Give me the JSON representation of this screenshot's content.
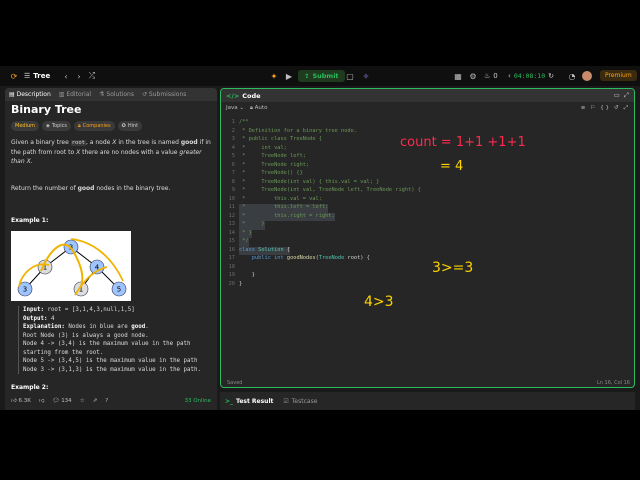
{
  "nav": {
    "problem_list_label": "Tree",
    "submit_label": "Submit",
    "timer": "04:08:10",
    "count": "0",
    "premium_label": "Premium"
  },
  "left": {
    "tabs": [
      {
        "label": "Description",
        "active": true
      },
      {
        "label": "Editorial"
      },
      {
        "label": "Solutions"
      },
      {
        "label": "Submissions"
      }
    ],
    "title": "Binary Tree",
    "chips": {
      "difficulty": "Medium",
      "topics": "Topics",
      "companies": "Companies",
      "hint": "Hint"
    },
    "description": {
      "p1_a": "Given a binary tree",
      "p1_code": "root",
      "p1_b": ", a node",
      "p1_x1": "X",
      "p1_c": "in the tree is named",
      "p1_good": "good",
      "p1_d": "if in the path from root to",
      "p1_x2": "X",
      "p1_e": "there are no nodes with a value",
      "p1_greater": "greater than",
      "p1_x3": "X",
      "p1_f": ".",
      "p2_a": "Return the number of",
      "p2_good": "good",
      "p2_b": "nodes in the binary tree."
    },
    "example1_label": "Example 1:",
    "example1": {
      "input_label": "Input:",
      "input_value": "root = [3,1,4,3,null,1,5]",
      "output_label": "Output:",
      "output_value": "4",
      "expl_label": "Explanation:",
      "expl_text": "Nodes in blue are",
      "expl_good": "good",
      "expl_end": ".",
      "lines": [
        "Root Node (3) is always a good node.",
        "Node 4 -> (3,4) is the maximum value in the path",
        "starting from the root.",
        "Node 5 -> (3,4,5) is the maximum value in the path",
        "Node 3 -> (3,1,3) is the maximum value in the path."
      ]
    },
    "tree_nodes": [
      "3",
      "1",
      "4",
      "3",
      "1",
      "5"
    ],
    "example2_label": "Example 2:",
    "example2_node": "3",
    "footer": {
      "likes": "6.3K",
      "comments": "134",
      "online": "33 Online"
    }
  },
  "right": {
    "header_label": "Code",
    "language": "Java",
    "mode": "Auto",
    "code_lines": [
      {
        "n": "1",
        "t": "/**",
        "c": "cm"
      },
      {
        "n": "2",
        "t": " * Definition for a binary tree node.",
        "c": "cm"
      },
      {
        "n": "3",
        "t": " * public class TreeNode {",
        "c": "cm"
      },
      {
        "n": "4",
        "t": " *     int val;",
        "c": "cm"
      },
      {
        "n": "5",
        "t": " *     TreeNode left;",
        "c": "cm"
      },
      {
        "n": "6",
        "t": " *     TreeNode right;",
        "c": "cm"
      },
      {
        "n": "7",
        "t": " *     TreeNode() {}",
        "c": "cm"
      },
      {
        "n": "8",
        "t": " *     TreeNode(int val) { this.val = val; }",
        "c": "cm"
      },
      {
        "n": "9",
        "t": " *     TreeNode(int val, TreeNode left, TreeNode right) {",
        "c": "cm"
      },
      {
        "n": "10",
        "t": " *         this.val = val;",
        "c": "cm"
      },
      {
        "n": "11",
        "t": " *         this.left = left;",
        "c": "cm",
        "sel": true
      },
      {
        "n": "12",
        "t": " *         this.right = right;",
        "c": "cm",
        "sel": true
      },
      {
        "n": "13",
        "t": " *     }",
        "c": "cm",
        "sel": true
      },
      {
        "n": "14",
        "t": " * }",
        "c": "cm",
        "sel": true
      },
      {
        "n": "15",
        "t": " */",
        "c": "cm",
        "sel": true
      },
      {
        "n": "16",
        "t": "class Solution {",
        "c": "code",
        "sel": true
      },
      {
        "n": "17",
        "t": "    public int goodNodes(TreeNode root) {",
        "c": "code"
      },
      {
        "n": "18",
        "t": "",
        "c": "code"
      },
      {
        "n": "19",
        "t": "    }",
        "c": "code"
      },
      {
        "n": "20",
        "t": "}",
        "c": "code"
      }
    ],
    "status": "Saved",
    "cursor_pos": "Ln 16, Col 16"
  },
  "annotations": {
    "count_text": "count = 1+1 +1+1",
    "eq_text": "= 4",
    "ineq1": "4>3",
    "ineq2": "3>=3",
    "ink_color": "#ffd400"
  },
  "bottom_tabs": {
    "test_result": "Test Result",
    "testcase": "Testcase"
  }
}
